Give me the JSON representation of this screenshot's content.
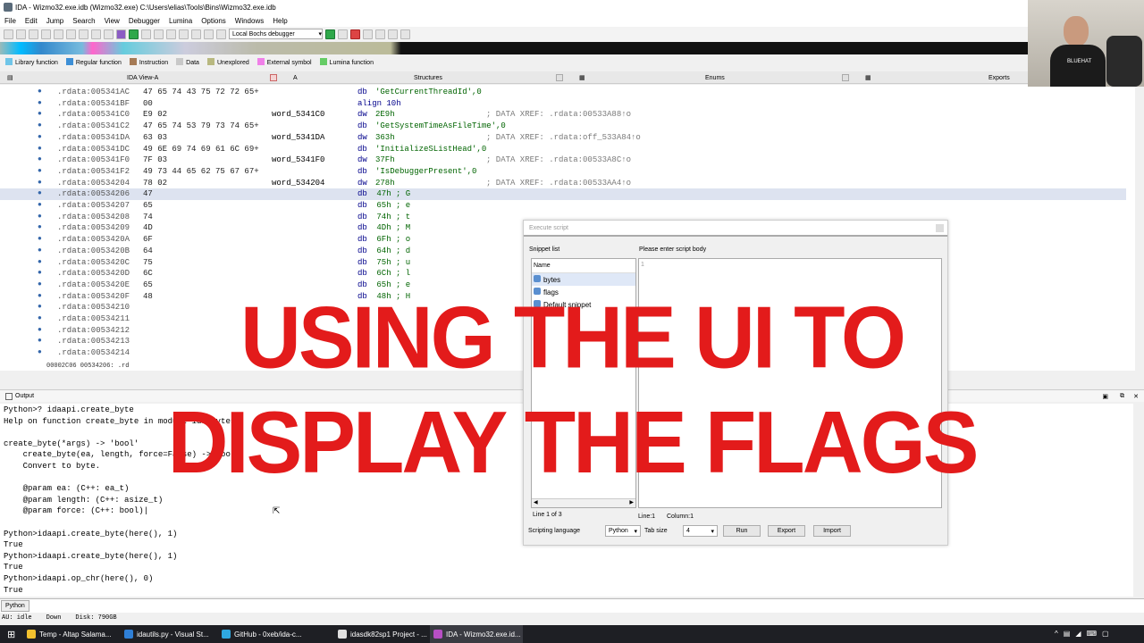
{
  "window": {
    "title": "IDA - Wizmo32.exe.idb (Wizmo32.exe) C:\\Users\\elias\\Tools\\Bins\\Wizmo32.exe.idb"
  },
  "menu": [
    "File",
    "Edit",
    "Jump",
    "Search",
    "View",
    "Debugger",
    "Lumina",
    "Options",
    "Windows",
    "Help"
  ],
  "toolbar": {
    "debugger_select": "Local Bochs debugger"
  },
  "legend": [
    {
      "label": "Library function",
      "color": "#6fc5e8"
    },
    {
      "label": "Regular function",
      "color": "#3d8fd6"
    },
    {
      "label": "Instruction",
      "color": "#a57a55"
    },
    {
      "label": "Data",
      "color": "#c8c8c8"
    },
    {
      "label": "Unexplored",
      "color": "#b8b880"
    },
    {
      "label": "External symbol",
      "color": "#f080e8"
    },
    {
      "label": "Lumina function",
      "color": "#66cc66"
    }
  ],
  "tabs": {
    "ida_view": "IDA View-A",
    "structures": "Structures",
    "enums": "Enums",
    "exports": "Exports"
  },
  "disasm": [
    {
      "addr": ".rdata:005341AC",
      "bytes": "47 65 74 43 75 72 72 65+",
      "label": "",
      "ins": "db",
      "arg": "'GetCurrentThreadId',0",
      "cmt": ""
    },
    {
      "addr": ".rdata:005341BF",
      "bytes": "00",
      "label": "",
      "ins": "align 10h",
      "arg": "",
      "cmt": ""
    },
    {
      "addr": ".rdata:005341C0",
      "bytes": "E9 02",
      "label": "word_5341C0",
      "ins": "dw",
      "arg": "2E9h",
      "cmt": "; DATA XREF: .rdata:00533A88↑o"
    },
    {
      "addr": ".rdata:005341C2",
      "bytes": "47 65 74 53 79 73 74 65+",
      "label": "",
      "ins": "db",
      "arg": "'GetSystemTimeAsFileTime',0",
      "cmt": ""
    },
    {
      "addr": ".rdata:005341DA",
      "bytes": "63 03",
      "label": "word_5341DA",
      "ins": "dw",
      "arg": "363h",
      "cmt": "; DATA XREF: .rdata:off_533A84↑o"
    },
    {
      "addr": ".rdata:005341DC",
      "bytes": "49 6E 69 74 69 61 6C 69+",
      "label": "",
      "ins": "db",
      "arg": "'InitializeSListHead',0",
      "cmt": ""
    },
    {
      "addr": ".rdata:005341F0",
      "bytes": "7F 03",
      "label": "word_5341F0",
      "ins": "dw",
      "arg": "37Fh",
      "cmt": "; DATA XREF: .rdata:00533A8C↑o"
    },
    {
      "addr": ".rdata:005341F2",
      "bytes": "49 73 44 65 62 75 67 67+",
      "label": "",
      "ins": "db",
      "arg": "'IsDebuggerPresent',0",
      "cmt": ""
    },
    {
      "addr": ".rdata:00534204",
      "bytes": "78 02",
      "label": "word_534204",
      "ins": "dw",
      "arg": "278h",
      "cmt": "; DATA XREF: .rdata:00533AA4↑o"
    },
    {
      "addr": ".rdata:00534206",
      "bytes": "47",
      "label": "",
      "ins": "db",
      "arg": " 47h ; G",
      "cmt": ""
    },
    {
      "addr": ".rdata:00534207",
      "bytes": "65",
      "label": "",
      "ins": "db",
      "arg": " 65h ; e",
      "cmt": ""
    },
    {
      "addr": ".rdata:00534208",
      "bytes": "74",
      "label": "",
      "ins": "db",
      "arg": " 74h ; t",
      "cmt": ""
    },
    {
      "addr": ".rdata:00534209",
      "bytes": "4D",
      "label": "",
      "ins": "db",
      "arg": " 4Dh ; M",
      "cmt": ""
    },
    {
      "addr": ".rdata:0053420A",
      "bytes": "6F",
      "label": "",
      "ins": "db",
      "arg": " 6Fh ; o",
      "cmt": ""
    },
    {
      "addr": ".rdata:0053420B",
      "bytes": "64",
      "label": "",
      "ins": "db",
      "arg": " 64h ; d",
      "cmt": ""
    },
    {
      "addr": ".rdata:0053420C",
      "bytes": "75",
      "label": "",
      "ins": "db",
      "arg": " 75h ; u",
      "cmt": ""
    },
    {
      "addr": ".rdata:0053420D",
      "bytes": "6C",
      "label": "",
      "ins": "db",
      "arg": " 6Ch ; l",
      "cmt": ""
    },
    {
      "addr": ".rdata:0053420E",
      "bytes": "65",
      "label": "",
      "ins": "db",
      "arg": " 65h ; e",
      "cmt": ""
    },
    {
      "addr": ".rdata:0053420F",
      "bytes": "48",
      "label": "",
      "ins": "db",
      "arg": " 48h ; H",
      "cmt": ""
    },
    {
      "addr": ".rdata:00534210",
      "bytes": "",
      "label": "",
      "ins": "",
      "arg": "",
      "cmt": ""
    },
    {
      "addr": ".rdata:00534211",
      "bytes": "",
      "label": "",
      "ins": "",
      "arg": "",
      "cmt": ""
    },
    {
      "addr": ".rdata:00534212",
      "bytes": "",
      "label": "",
      "ins": "",
      "arg": "",
      "cmt": ""
    },
    {
      "addr": ".rdata:00534213",
      "bytes": "",
      "label": "",
      "ins": "",
      "arg": "",
      "cmt": ""
    },
    {
      "addr": ".rdata:00534214",
      "bytes": "",
      "label": "",
      "ins": "",
      "arg": "",
      "cmt": ""
    }
  ],
  "disasm_status": "00002C06 00534206: .rd",
  "output": {
    "title": "Output",
    "text": "Python>? idaapi.create_byte\nHelp on function create_byte in module ida_bytes:\n\ncreate_byte(*args) -> 'bool'\n    create_byte(ea, length, force=False) -> bool\n    Convert to byte.\n\n    @param ea: (C++: ea_t)\n    @param length: (C++: asize_t)\n    @param force: (C++: bool)|\n\nPython>idaapi.create_byte(here(), 1)\nTrue\nPython>idaapi.create_byte(here(), 1)\nTrue\nPython>idaapi.op_chr(here(), 0)\nTrue"
  },
  "python_button": "Python",
  "status_bar": {
    "state": "AU:  idle",
    "direction": "Down",
    "disk": "Disk: 790GB"
  },
  "dialog": {
    "title": "Execute script",
    "snippet_list_label": "Snippet list",
    "script_body_label": "Please enter script body",
    "name_header": "Name",
    "snippets": [
      "bytes",
      "flags",
      "Default snippet"
    ],
    "line_of": "Line 1 of 3",
    "line_num": "1",
    "cursor_line": "Line:1",
    "cursor_col": "Column:1",
    "lang_label": "Scripting language",
    "lang_value": "Python",
    "tab_label": "Tab size",
    "tab_value": "4",
    "run": "Run",
    "export": "Export",
    "import": "Import"
  },
  "overlay_text": "USING THE UI TO DISPLAY THE FLAGS",
  "webcam_badge": "BLUEHAT",
  "taskbar": [
    {
      "label": "Temp - Altap Salama...",
      "color": "#f2c12e"
    },
    {
      "label": "idautils.py - Visual St...",
      "color": "#2f7fd6"
    },
    {
      "label": "GitHub - 0xeb/ida-c...",
      "color": "#2fa8e0"
    },
    {
      "label": "idasdk82sp1 Project - ...",
      "color": "#e0e0e0"
    },
    {
      "label": "IDA - Wizmo32.exe.id...",
      "color": "#b84fc4"
    }
  ]
}
